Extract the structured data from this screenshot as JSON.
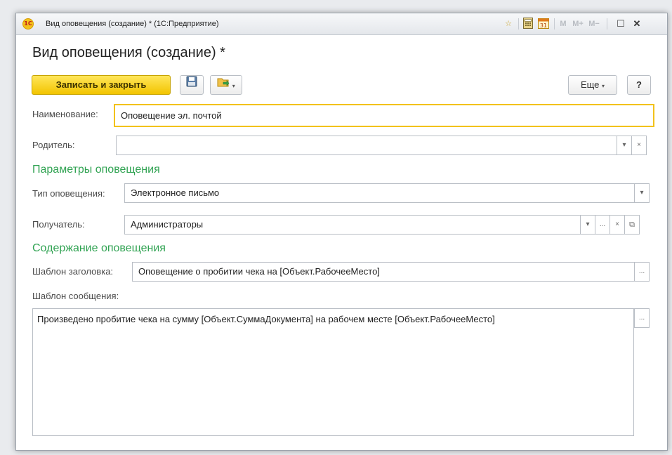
{
  "window": {
    "title": "Вид оповещения (создание) * (1С:Предприятие)",
    "logo_text": "1С",
    "toolbar_icons": [
      "star-icon",
      "calculator-icon",
      "calendar-icon",
      "m-icon",
      "m-plus-icon",
      "m-minus-icon",
      "maximize-icon",
      "close-icon"
    ],
    "calendar_day": "31",
    "mem_labels": [
      "M",
      "M+",
      "M−"
    ],
    "maximize_glyph": "☐",
    "close_glyph": "✕"
  },
  "form": {
    "title": "Вид оповещения (создание) *"
  },
  "toolbar": {
    "save_close_label": "Записать и закрыть",
    "more_label": "Еще",
    "help_label": "?"
  },
  "fields": {
    "name": {
      "label": "Наименование:",
      "value": "Оповещение эл. почтой"
    },
    "parent": {
      "label": "Родитель:",
      "value": ""
    },
    "notification_type": {
      "label": "Тип оповещения:",
      "value": "Электронное письмо"
    },
    "recipient": {
      "label": "Получатель:",
      "value": "Администраторы"
    },
    "subject_template": {
      "label": "Шаблон заголовка:",
      "value": "Оповещение о пробитии чека на [Объект.РабочееМесто]"
    },
    "message_template": {
      "label": "Шаблон сообщения:",
      "value": "Произведено пробитие чека на сумму [Объект.СуммаДокумента] на рабочем месте [Объект.РабочееМесто]"
    }
  },
  "sections": {
    "params": "Параметры оповещения",
    "content": "Содержание оповещения"
  },
  "glyphs": {
    "dropdown": "▾",
    "clear": "×",
    "ellipsis": "...",
    "open": "⧉"
  },
  "colors": {
    "accent": "#f2c400",
    "section_green": "#31a353",
    "focus_border": "#f2c21b"
  }
}
